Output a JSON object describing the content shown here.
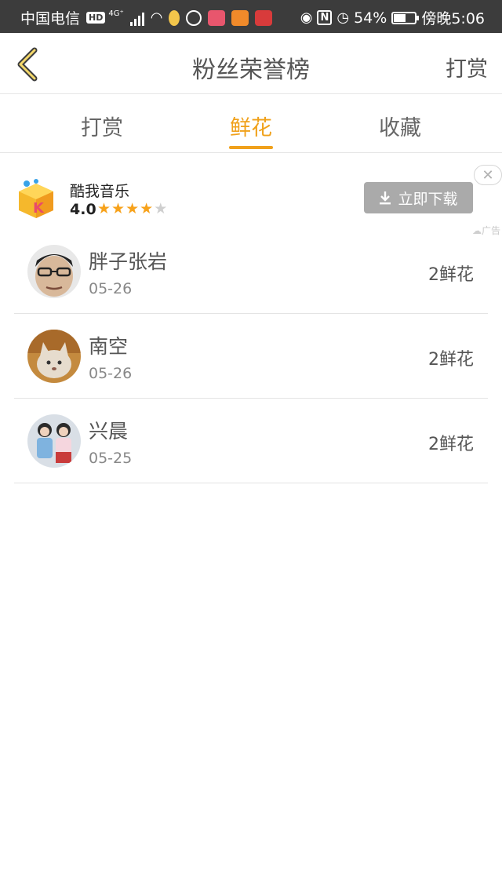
{
  "status_bar": {
    "carrier": "中国电信",
    "hd_badge": "HD",
    "network": "4G⁺",
    "battery": "54%",
    "time": "傍晚5:06",
    "icons": [
      "signal-icon",
      "wifi-icon",
      "notification-icon",
      "vpn-icon",
      "app-icon",
      "video-icon",
      "reader-icon",
      "eye-icon",
      "nfc-icon",
      "alarm-icon",
      "battery-icon"
    ]
  },
  "header": {
    "title": "粉丝荣誉榜",
    "right_action": "打赏"
  },
  "tabs": [
    {
      "label": "打赏",
      "active": false
    },
    {
      "label": "鲜花",
      "active": true
    },
    {
      "label": "收藏",
      "active": false
    }
  ],
  "accent_color": "#f0a11b",
  "ad": {
    "app_name": "酷我音乐",
    "rating": "4.0",
    "stars_filled": 4,
    "stars_total": 5,
    "button_label": "立即下载",
    "close_symbol": "✕",
    "tag": "广告"
  },
  "fans": [
    {
      "name": "胖子张岩",
      "date": "05-26",
      "count": "2鲜花"
    },
    {
      "name": "南空",
      "date": "05-26",
      "count": "2鲜花"
    },
    {
      "name": "兴晨",
      "date": "05-25",
      "count": "2鲜花"
    }
  ]
}
